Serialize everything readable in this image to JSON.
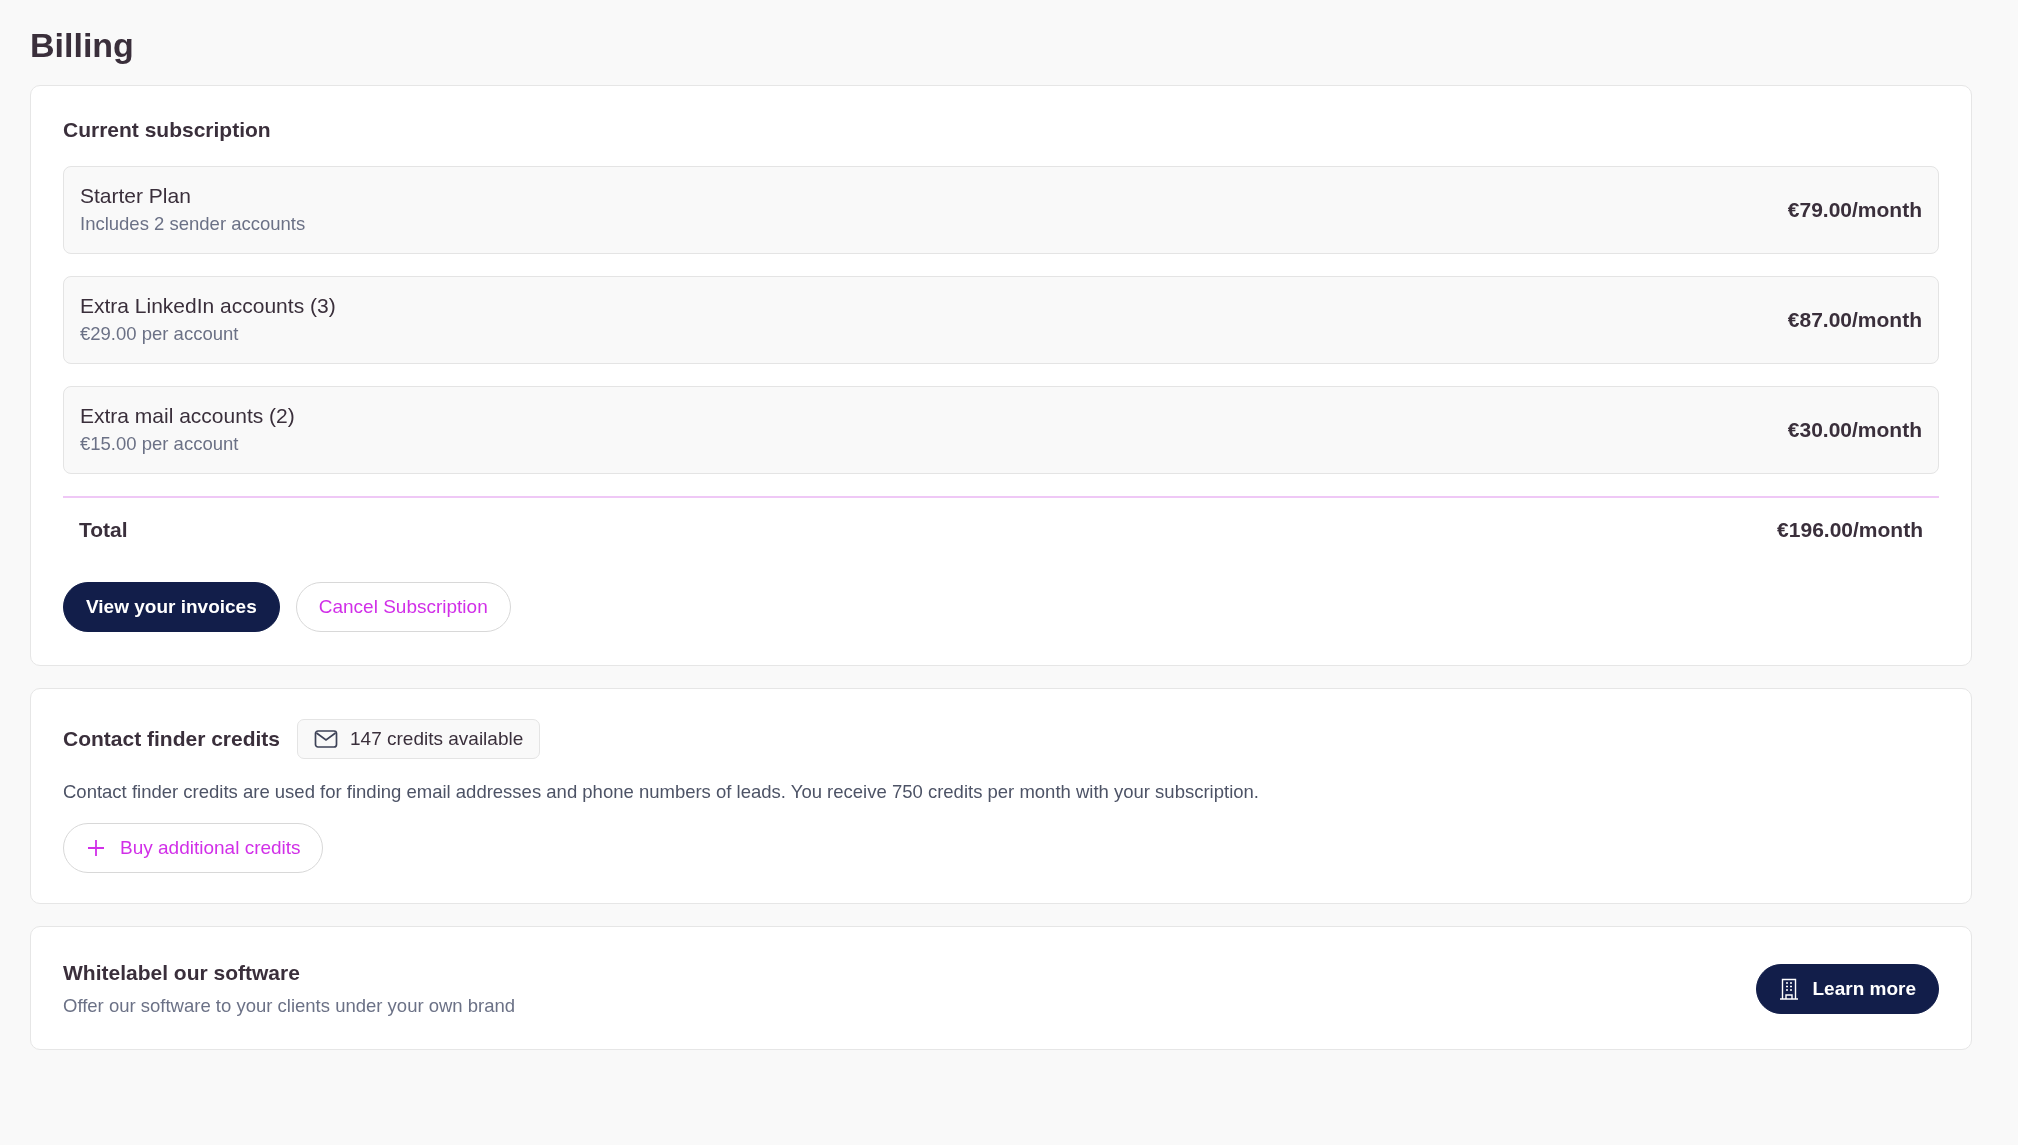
{
  "page_title": "Billing",
  "subscription": {
    "title": "Current subscription",
    "items": [
      {
        "name": "Starter Plan",
        "detail": "Includes 2 sender accounts",
        "price": "€79.00/month"
      },
      {
        "name": "Extra LinkedIn accounts (3)",
        "detail": "€29.00 per account",
        "price": "€87.00/month"
      },
      {
        "name": "Extra mail accounts (2)",
        "detail": "€15.00 per account",
        "price": "€30.00/month"
      }
    ],
    "total_label": "Total",
    "total_price": "€196.00/month",
    "buttons": [
      {
        "label": "View your invoices",
        "kind": "primary"
      },
      {
        "label": "Cancel Subscription",
        "kind": "outline"
      }
    ]
  },
  "credits": {
    "title": "Contact finder credits",
    "badge": "147 credits available",
    "description": "Contact finder credits are used for finding email addresses and phone numbers of leads. You receive 750 credits per month with your subscription.",
    "button": "Buy additional credits"
  },
  "whitelabel": {
    "title": "Whitelabel our software",
    "description": "Offer our software to your clients under your own brand",
    "button": "Learn more"
  }
}
